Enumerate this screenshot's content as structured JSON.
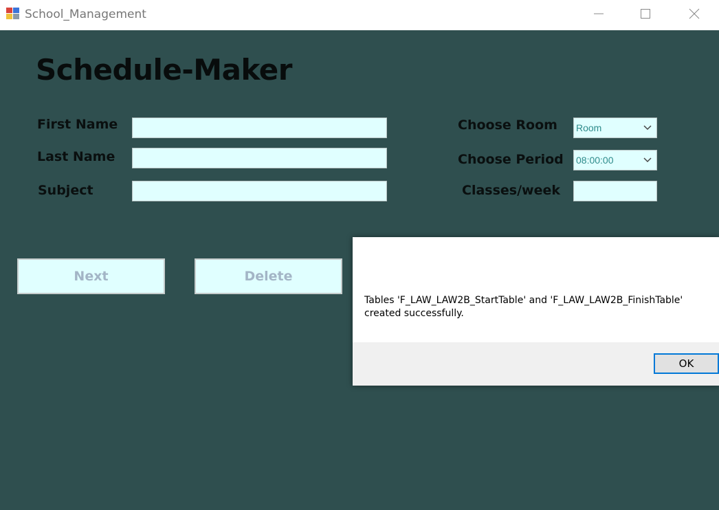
{
  "window": {
    "title": "School_Management",
    "icon": "app-form-icon",
    "controls": [
      "minimize-icon",
      "maximize-icon",
      "close-icon"
    ]
  },
  "form": {
    "heading": "Schedule-Maker",
    "first_name_label": "First Name",
    "last_name_label": "Last Name",
    "subject_label": "Subject",
    "first_name_value": "",
    "last_name_value": "",
    "subject_value": "",
    "room_label": "Choose Room",
    "room_value": "Room",
    "period_label": "Choose Period",
    "period_value": "08:00:00",
    "classes_label": "Classes/week",
    "classes_value": "",
    "next_label": "Next",
    "delete_label": "Delete"
  },
  "dialog": {
    "line1": "Tables 'F_LAW_LAW2B_StartTable' and 'F_LAW_LAW2B_FinishTable'",
    "line2": "created successfully.",
    "ok_label": "OK"
  },
  "colors": {
    "background": "#2f4f4f",
    "field": "#e0ffff",
    "button_text": "#a3b5c6",
    "accent": "#0078d7"
  }
}
